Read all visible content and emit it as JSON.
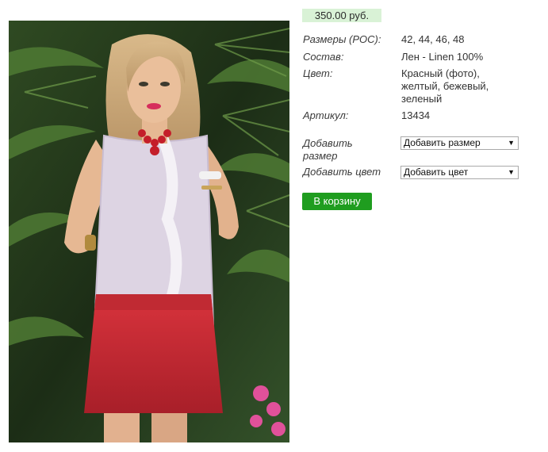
{
  "product": {
    "price": "350.00 руб.",
    "properties": [
      {
        "label": "Размеры (РОС):",
        "value": "42, 44, 46, 48"
      },
      {
        "label": "Состав:",
        "value": "Лен - Linen 100%"
      },
      {
        "label": "Цвет:",
        "value": "Красный (фото), желтый, бежевый, зеленый"
      },
      {
        "label": "Артикул:",
        "value": "13434"
      }
    ]
  },
  "options": {
    "size": {
      "label": "Добавить размер",
      "selected": "Добавить размер"
    },
    "color": {
      "label": "Добавить цвет",
      "selected": "Добавить цвет"
    }
  },
  "cart": {
    "button_label": "В корзину"
  },
  "colors": {
    "price_bg": "#d9f2d6",
    "button_bg": "#1f9d1f"
  }
}
